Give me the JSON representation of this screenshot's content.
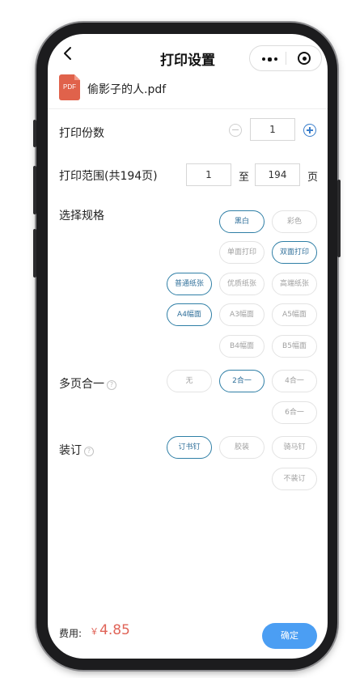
{
  "nav": {
    "title": "打印设置"
  },
  "file": {
    "badge": "PDF",
    "name": "偷影子的人.pdf"
  },
  "copies": {
    "label": "打印份数",
    "value": "1"
  },
  "range": {
    "label": "打印范围(共194页)",
    "from": "1",
    "separator": "至",
    "to": "194",
    "unit": "页"
  },
  "spec": {
    "label": "选择规格",
    "color_options": [
      "黑白",
      "彩色"
    ],
    "side_options": [
      "单面打印",
      "双面打印"
    ],
    "paper_options": [
      "普通纸张",
      "优质纸张",
      "高端纸张"
    ],
    "size_options": [
      "A4幅面",
      "A3幅面",
      "A5幅面",
      "B4幅面",
      "B5幅面"
    ]
  },
  "multi": {
    "label": "多页合一",
    "help": "?",
    "options": [
      "无",
      "2合一",
      "4合一",
      "6合一"
    ]
  },
  "binding": {
    "label": "装订",
    "help": "?",
    "options": [
      "订书钉",
      "胶装",
      "骑马钉",
      "不装订"
    ]
  },
  "footer": {
    "fee_label": "费用:",
    "currency": "￥",
    "price": "4.85",
    "confirm_label": "确定"
  },
  "colors": {
    "accent": "#4b9ef3",
    "selected_border": "#2f7fa6",
    "price": "#e06458",
    "pdf_icon": "#e0624b"
  },
  "icons": [
    "back-arrow-icon",
    "more-dots-icon",
    "close-target-icon",
    "pdf-file-icon",
    "minus-circle-icon",
    "plus-circle-icon",
    "help-icon"
  ]
}
